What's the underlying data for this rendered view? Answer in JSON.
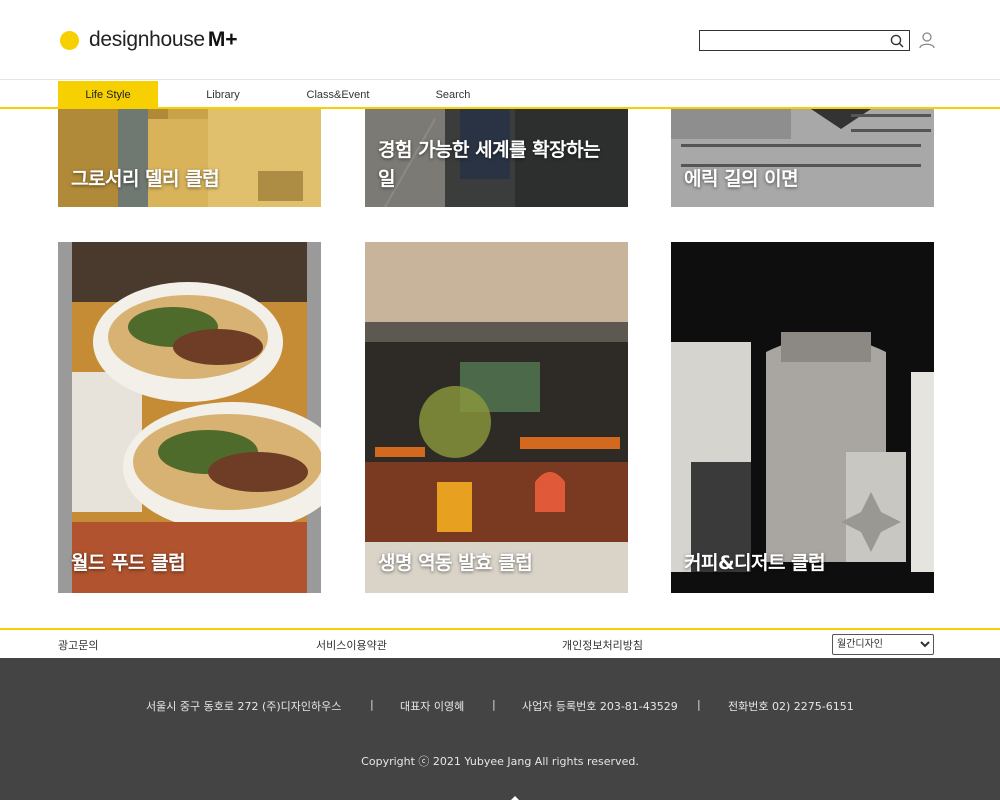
{
  "header": {
    "logo_text": "designhouse",
    "logo_mark": "M+",
    "search": {
      "value": "",
      "placeholder": ""
    },
    "search_icon": "search-icon",
    "user_icon": "user-icon"
  },
  "nav": {
    "tabs": [
      {
        "label": "Life Style",
        "active": true
      },
      {
        "label": "Library",
        "active": false
      },
      {
        "label": "Class&Event",
        "active": false
      },
      {
        "label": "Search",
        "active": false
      }
    ]
  },
  "cards": [
    {
      "title": "그로서리 델리 클럽",
      "image": "grocery-deli-photo"
    },
    {
      "title": "경험 가능한 세계를 확장하는 일",
      "image": "street-walk-photo"
    },
    {
      "title": "에릭 길의 이면",
      "image": "engraved-text-print-photo"
    },
    {
      "title": "월드 푸드 클럽",
      "image": "tacos-photo"
    },
    {
      "title": "생명 역동 발효 클럽",
      "image": "cafe-interior-photo"
    },
    {
      "title": "커피&디저트 클럽",
      "image": "coffee-bags-photo"
    }
  ],
  "footer_links": {
    "ad": "광고문의",
    "terms": "서비스이용약관",
    "privacy": "개인정보처리방침",
    "family_select": "월간디자인"
  },
  "footer": {
    "address": "서울시 중구 동호로 272 (주)디자인하우스",
    "ceo": "대표자 이영혜",
    "biz_no": "사업자 등록번호 203-81-43529",
    "phone": "전화번호 02) 2275-6151",
    "separator": "|",
    "copyright": "Copyright ⓒ 2021 Yubyee Jang All rights reserved."
  },
  "colors": {
    "accent": "#f6d000",
    "footer_bg": "#444444"
  }
}
